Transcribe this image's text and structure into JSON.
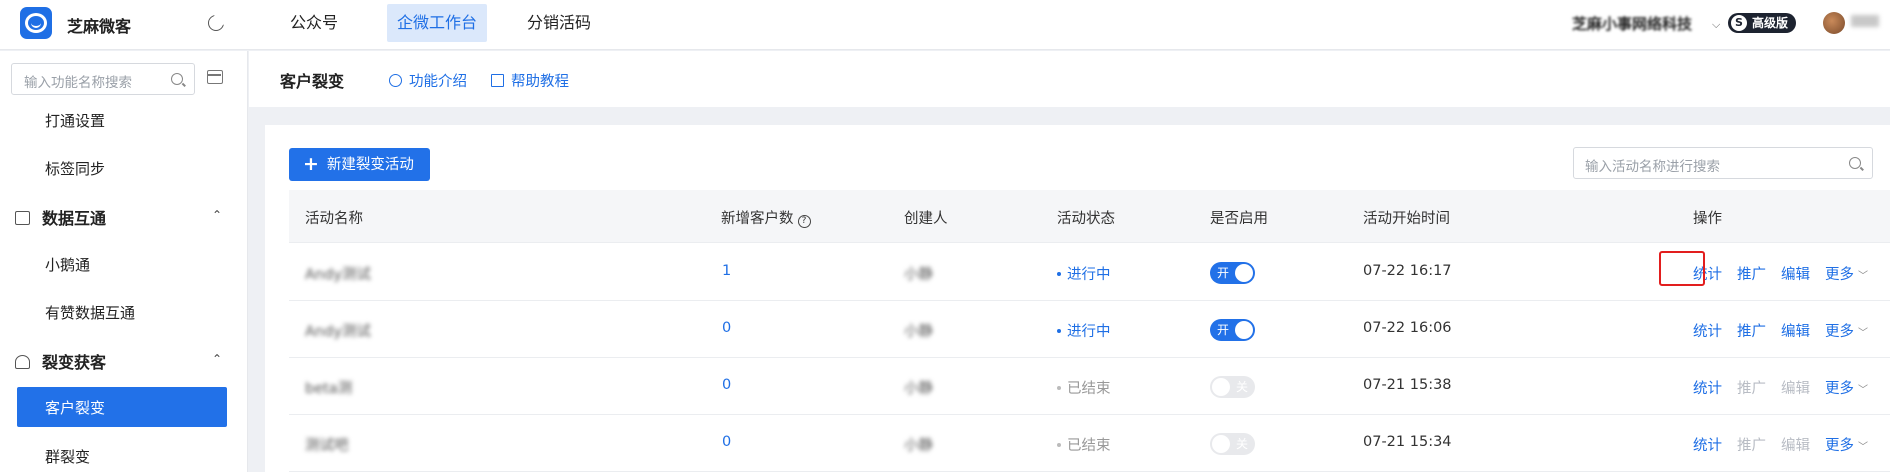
{
  "app": {
    "brand": "芝麻微客"
  },
  "topnav": [
    {
      "label": "公众号",
      "active": false
    },
    {
      "label": "企微工作台",
      "active": true
    },
    {
      "label": "分销活码",
      "active": false
    }
  ],
  "account": {
    "company": "芝麻小事网络科技",
    "edition": "高级版",
    "edition_icon": "S"
  },
  "sidebar": {
    "search_placeholder": "输入功能名称搜索",
    "items": [
      {
        "label": "打通设置"
      },
      {
        "label": "标签同步"
      },
      {
        "label": "数据互通",
        "group": true
      },
      {
        "label": "小鹅通"
      },
      {
        "label": "有赞数据互通"
      },
      {
        "label": "裂变获客",
        "group": true
      },
      {
        "label": "客户裂变",
        "active": true
      },
      {
        "label": "群裂变"
      }
    ]
  },
  "subheader": {
    "title": "客户裂变",
    "links": [
      {
        "label": "功能介绍"
      },
      {
        "label": "帮助教程"
      }
    ]
  },
  "panel": {
    "new_button": "新建裂变活动",
    "search_placeholder": "输入活动名称进行搜索",
    "columns": [
      "活动名称",
      "新增客户数",
      "创建人",
      "活动状态",
      "是否启用",
      "活动开始时间",
      "操作"
    ],
    "rows": [
      {
        "name": "Andy测试",
        "new_customers": "1",
        "creator": "小静",
        "status": "进行中",
        "enabled": "开",
        "start_time": "07-22 16:17",
        "ops": [
          "统计",
          "推广",
          "编辑",
          "更多"
        ]
      },
      {
        "name": "Andy测试",
        "new_customers": "0",
        "creator": "小静",
        "status": "进行中",
        "enabled": "开",
        "start_time": "07-22 16:06",
        "ops": [
          "统计",
          "推广",
          "编辑",
          "更多"
        ]
      },
      {
        "name": "beta测",
        "new_customers": "0",
        "creator": "小静",
        "status": "已结束",
        "enabled": "关",
        "start_time": "07-21 15:38",
        "ops": [
          "统计",
          "推广",
          "编辑",
          "更多"
        ]
      },
      {
        "name": "测试吧",
        "new_customers": "0",
        "creator": "小静",
        "status": "已结束",
        "enabled": "关",
        "start_time": "07-21 15:34",
        "ops": [
          "统计",
          "推广",
          "编辑",
          "更多"
        ]
      }
    ]
  },
  "colors": {
    "accent": "#2271e8",
    "highlight": "#e21e1e"
  }
}
